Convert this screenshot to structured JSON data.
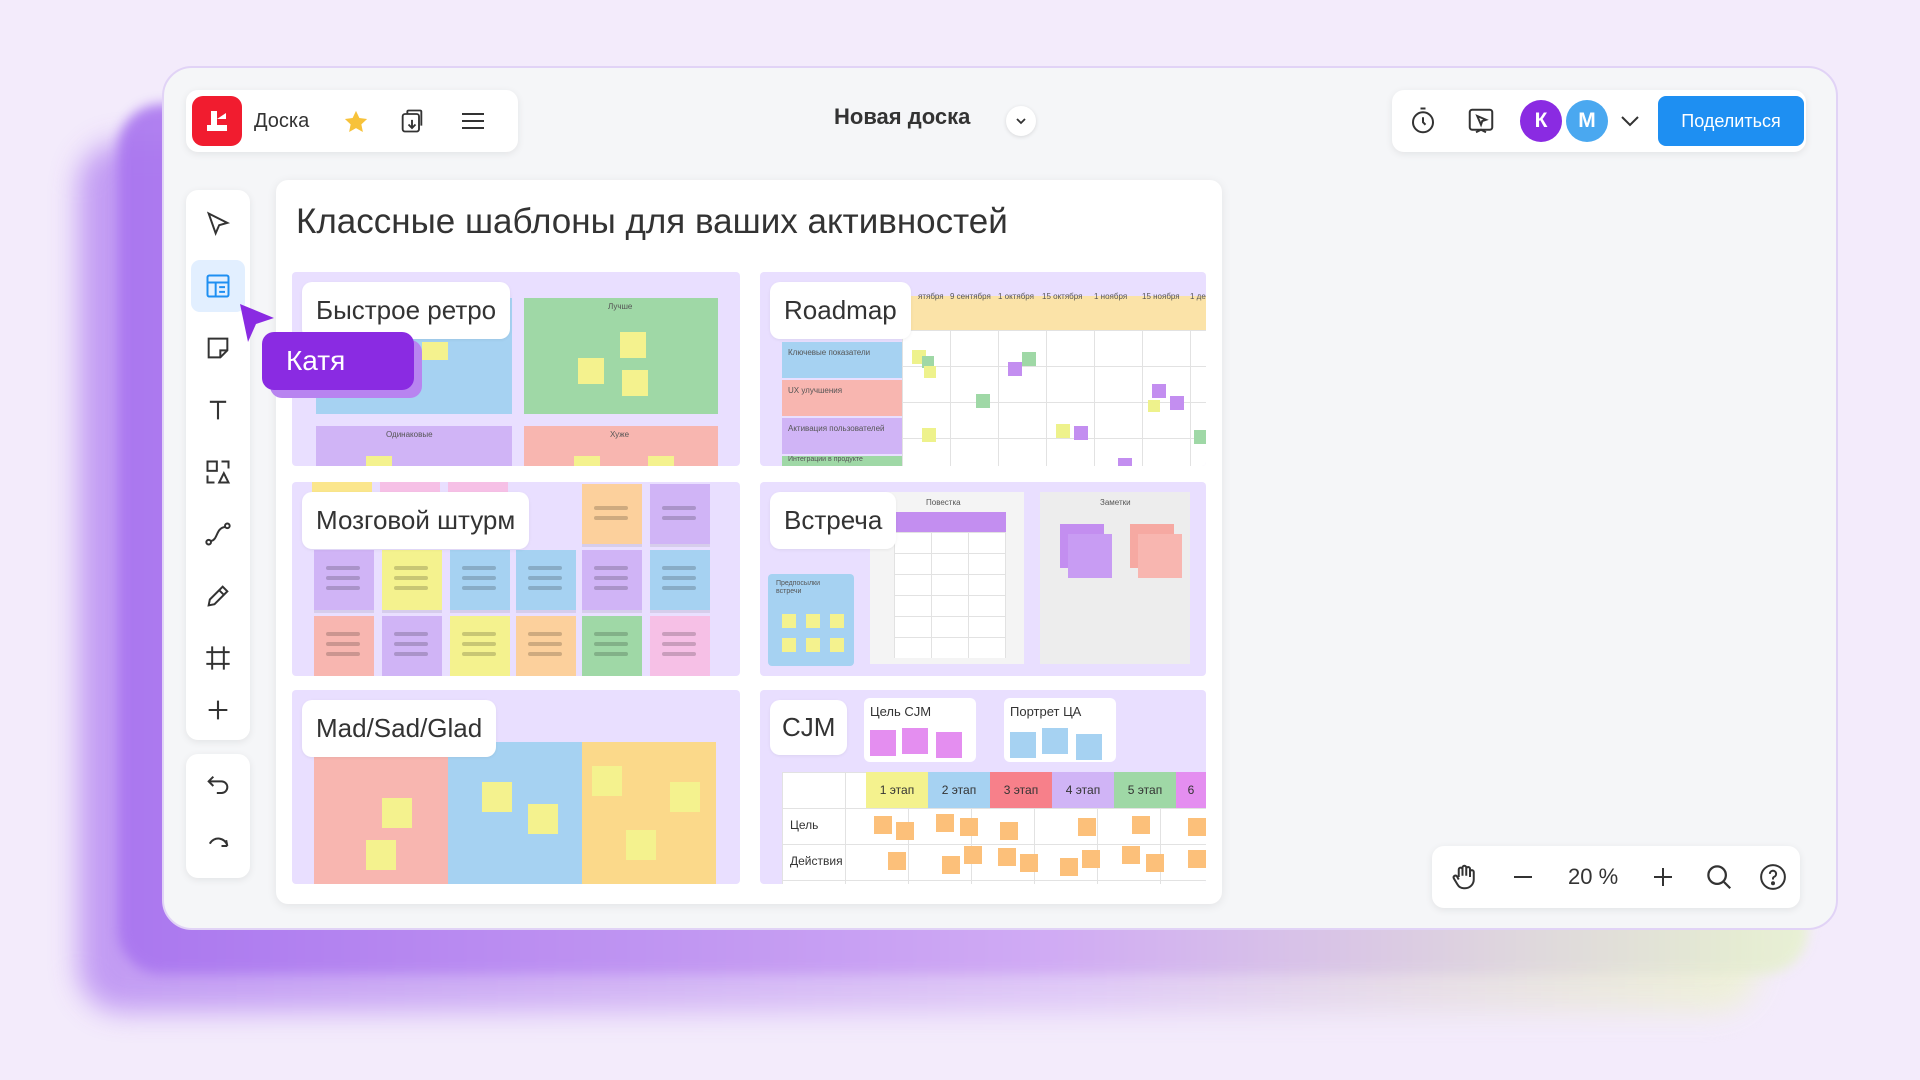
{
  "app": {
    "name": "Доска"
  },
  "board": {
    "title": "Новая доска"
  },
  "share_label": "Поделиться",
  "avatars": [
    {
      "letter": "К",
      "color": "#8a2be2"
    },
    {
      "letter": "М",
      "color": "#4aa8f0"
    }
  ],
  "frame": {
    "title": "Классные шаблоны для ваших активностей"
  },
  "templates": {
    "retro": {
      "label": "Быстрое ретро",
      "columns": [
        "Лучше",
        "Одинаковые",
        "Хуже"
      ]
    },
    "roadmap": {
      "label": "Roadmap",
      "dates": [
        "ятября",
        "9 сентября",
        "1 октября",
        "15 октября",
        "1 ноября",
        "15 ноября",
        "1 де"
      ],
      "rows": [
        "Ключевые показатели",
        "UX улучшения",
        "Активация пользователей",
        "Интеграции в продукте"
      ]
    },
    "brainstorm": {
      "label": "Мозговой штурм"
    },
    "meeting": {
      "label": "Встреча",
      "agenda": "Повестка",
      "notes": "Заметки",
      "prereq": "Предпосылки встречи"
    },
    "madsadglad": {
      "label": "Mad/Sad/Glad"
    },
    "cjm": {
      "label": "CJM",
      "goal_card": "Цель CJM",
      "persona_card": "Портрет ЦА",
      "stages": [
        "1 этап",
        "2 этап",
        "3 этап",
        "4 этап",
        "5 этап",
        "6"
      ],
      "rows": [
        "Цель",
        "Действия"
      ]
    }
  },
  "cursor": {
    "name": "Катя"
  },
  "zoom": {
    "level": "20 %"
  },
  "colors": {
    "accent": "#1e8ff2",
    "logo": "#f11c2f",
    "cursor": "#8a2be2"
  }
}
